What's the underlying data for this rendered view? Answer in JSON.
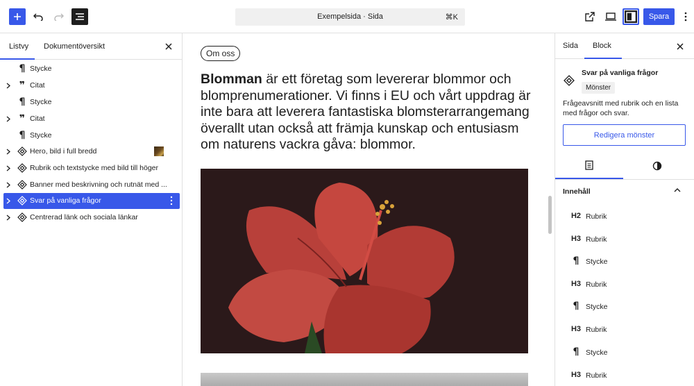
{
  "topbar": {
    "command_title": "Exempelsida · Sida",
    "command_shortcut": "⌘K",
    "save_label": "Spara",
    "accent_color": "#3858e9"
  },
  "left_panel": {
    "tabs": [
      "Listvy",
      "Dokumentöversikt"
    ],
    "active_tab": "Listvy",
    "items": [
      {
        "icon": "paragraph-icon",
        "label": "Stycke",
        "expandable": false
      },
      {
        "icon": "quote-icon",
        "label": "Citat",
        "expandable": true
      },
      {
        "icon": "paragraph-icon",
        "label": "Stycke",
        "expandable": false
      },
      {
        "icon": "quote-icon",
        "label": "Citat",
        "expandable": true
      },
      {
        "icon": "paragraph-icon",
        "label": "Stycke",
        "expandable": false
      },
      {
        "icon": "pattern-icon",
        "label": "Hero, bild i full bredd",
        "expandable": true
      },
      {
        "icon": "pattern-icon",
        "label": "Rubrik och textstycke med bild till höger",
        "expandable": true
      },
      {
        "icon": "pattern-icon",
        "label": "Banner med beskrivning och rutnät med ...",
        "expandable": true
      },
      {
        "icon": "pattern-icon",
        "label": "Svar på vanliga frågor",
        "expandable": true,
        "selected": true
      },
      {
        "icon": "pattern-icon",
        "label": "Centrerad länk och sociala länkar",
        "expandable": true
      }
    ]
  },
  "canvas": {
    "pill": "Om oss",
    "lead_bold": "Blomman",
    "lead_rest": " är ett företag som levererar blommor och blomprenumerationer. Vi finns i EU och vårt uppdrag är inte bara att leverera fantastiska blomsterarrangemang överallt utan också att främja kunskap och entusiasm om naturens vackra gåva: blommor."
  },
  "right_panel": {
    "tabs": [
      "Sida",
      "Block"
    ],
    "active_tab": "Block",
    "block_title": "Svar på vanliga frågor",
    "block_badge": "Mönster",
    "block_description": "Frågeavsnitt med rubrik och en lista med frågor och svar.",
    "edit_button": "Redigera mönster",
    "section_title": "Innehåll",
    "content_items": [
      {
        "icon": "H2",
        "label": "Rubrik"
      },
      {
        "icon": "H3",
        "label": "Rubrik"
      },
      {
        "icon": "¶",
        "label": "Stycke"
      },
      {
        "icon": "H3",
        "label": "Rubrik"
      },
      {
        "icon": "¶",
        "label": "Stycke"
      },
      {
        "icon": "H3",
        "label": "Rubrik"
      },
      {
        "icon": "¶",
        "label": "Stycke"
      },
      {
        "icon": "H3",
        "label": "Rubrik"
      }
    ]
  }
}
